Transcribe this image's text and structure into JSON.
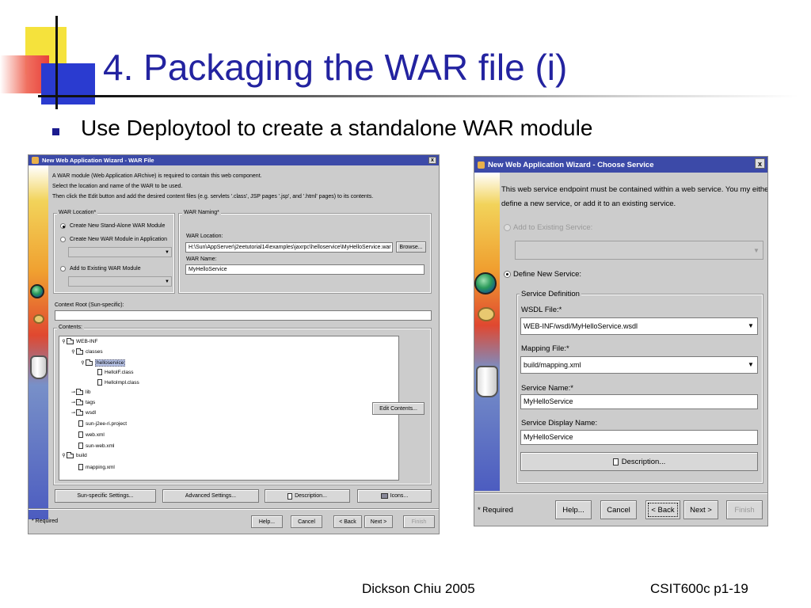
{
  "slide": {
    "title": "4. Packaging the WAR file (i)",
    "bullet": "Use Deploytool to create a standalone WAR module",
    "footer_author": "Dickson Chiu 2005",
    "footer_course": "CSIT600c p1-19"
  },
  "war_wizard": {
    "title": "New Web Application Wizard - WAR File",
    "close": "x",
    "intro_lines": [
      "A WAR module (Web Application ARchive) is required to contain this web component.",
      "Select the location and name of the WAR to be used.",
      "Then click the Edit button and add the desired content files (e.g. servlets '.class', JSP pages '.jsp', and '.html' pages) to its contents."
    ],
    "war_location": {
      "legend": "WAR Location*",
      "options": [
        "Create New Stand-Alone WAR Module",
        "Create New WAR Module in Application",
        "Add to Existing WAR Module"
      ],
      "selected": 0
    },
    "war_naming": {
      "legend": "WAR Naming*",
      "location_label": "WAR Location:",
      "location_value": "H:\\Sun\\AppServer\\j2eetutorial14\\examples\\jaxrpc\\helloservice\\MyHelloService.war",
      "browse": "Browse...",
      "name_label": "WAR Name:",
      "name_value": "MyHelloService"
    },
    "context_root_label": "Context Root (Sun-specific):",
    "context_root_value": "",
    "contents_legend": "Contents:",
    "tree": [
      {
        "label": "WEB-INF",
        "level": 0,
        "kind": "folder",
        "toggle": "open"
      },
      {
        "label": "classes",
        "level": 1,
        "kind": "folder",
        "toggle": "open"
      },
      {
        "label": "helloservice",
        "level": 2,
        "kind": "folder",
        "toggle": "open",
        "selected": true
      },
      {
        "label": "HelloIF.class",
        "level": 3,
        "kind": "file"
      },
      {
        "label": "HelloImpl.class",
        "level": 3,
        "kind": "file"
      },
      {
        "label": "lib",
        "level": 1,
        "kind": "folder",
        "toggle": "closed"
      },
      {
        "label": "tags",
        "level": 1,
        "kind": "folder",
        "toggle": "closed"
      },
      {
        "label": "wsdl",
        "level": 1,
        "kind": "folder",
        "toggle": "closed"
      },
      {
        "label": "sun-j2ee-ri.project",
        "level": 1,
        "kind": "file"
      },
      {
        "label": "web.xml",
        "level": 1,
        "kind": "file"
      },
      {
        "label": "sun-web.xml",
        "level": 1,
        "kind": "file"
      },
      {
        "label": "build",
        "level": 0,
        "kind": "folder",
        "toggle": "open"
      },
      {
        "label": "mapping.xml",
        "level": 1,
        "kind": "file"
      }
    ],
    "edit_contents": "Edit Contents...",
    "bottom_buttons": {
      "sun_specific": "Sun-specific Settings...",
      "advanced": "Advanced Settings...",
      "description": "Description...",
      "icons": "Icons..."
    },
    "required_note": "* Required",
    "nav": {
      "help": "Help...",
      "cancel": "Cancel",
      "back": "< Back",
      "next": "Next >",
      "finish": "Finish"
    }
  },
  "service_wizard": {
    "title": "New Web Application Wizard - Choose Service",
    "close": "x",
    "intro_lines": [
      "This web service endpoint must be contained within a web service. You my either",
      "define a new service, or add it to an existing service."
    ],
    "add_existing_label": "Add to Existing Service:",
    "define_new_label": "Define New Service:",
    "service_def_legend": "Service Definition",
    "wsdl_label": "WSDL File:*",
    "wsdl_value": "WEB-INF/wsdl/MyHelloService.wsdl",
    "mapping_label": "Mapping File:*",
    "mapping_value": "build/mapping.xml",
    "service_name_label": "Service Name:*",
    "service_name_value": "MyHelloService",
    "display_name_label": "Service Display Name:",
    "display_name_value": "MyHelloService",
    "description": "Description...",
    "required_note": "* Required",
    "nav": {
      "help": "Help...",
      "cancel": "Cancel",
      "back": "< Back",
      "next": "Next >",
      "finish": "Finish"
    }
  },
  "icons": {
    "bullet": "square-bullet-icon",
    "close": "close-icon",
    "combo": "chevron-down-icon",
    "document": "document-icon",
    "folder": "folder-icon",
    "file": "file-icon"
  },
  "colors": {
    "title": "#2323a0",
    "titlebar": "#3c4aa8",
    "dialog_bg": "#cccccc"
  }
}
